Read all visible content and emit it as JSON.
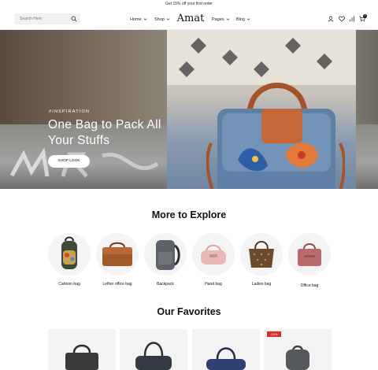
{
  "announcement": "Get 15% off your first order",
  "header": {
    "search_placeholder": "Search Here",
    "logo": "Amat",
    "nav": [
      {
        "label": "Home"
      },
      {
        "label": "Shop"
      },
      {
        "label": "Pages"
      },
      {
        "label": "Blog"
      }
    ],
    "cart_count": "0"
  },
  "hero": {
    "tag": "#INSPIRATION",
    "title": "One Bag to Pack All Your Stuffs",
    "button": "SHOP LOOK"
  },
  "explore": {
    "title": "More to Explore",
    "categories": [
      {
        "label": "Cartoon bag",
        "icon": "backpack-icon"
      },
      {
        "label": "Lether office bag",
        "icon": "briefcase-icon"
      },
      {
        "label": "Backpack",
        "icon": "backpack-icon"
      },
      {
        "label": "Hand bag",
        "icon": "handbag-icon"
      },
      {
        "label": "Ladies bag",
        "icon": "tote-icon"
      },
      {
        "label": "Office bag",
        "icon": "office-bag-icon"
      }
    ]
  },
  "favorites": {
    "title": "Our Favorites",
    "badge": "-14%"
  },
  "colors": {
    "accent": "#111111",
    "sale": "#d9302c",
    "hero_bag": "#5f7fa6"
  }
}
